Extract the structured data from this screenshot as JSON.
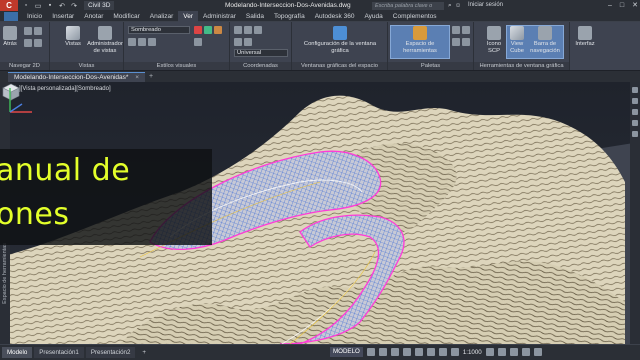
{
  "window": {
    "app_logo": "C",
    "product": "Civil 3D",
    "document_title": "Modelando-Interseccion-Dos-Avenidas.dwg",
    "search_placeholder": "Escriba palabra clave o frase",
    "signin": "Iniciar sesión",
    "controls": [
      "–",
      "□",
      "✕"
    ]
  },
  "ribbon_tabs": [
    {
      "label": "Inicio",
      "active": false
    },
    {
      "label": "Insertar",
      "active": false
    },
    {
      "label": "Anotar",
      "active": false
    },
    {
      "label": "Modificar",
      "active": false
    },
    {
      "label": "Analizar",
      "active": false
    },
    {
      "label": "Ver",
      "active": true
    },
    {
      "label": "Administrar",
      "active": false
    },
    {
      "label": "Salida",
      "active": false
    },
    {
      "label": "Topografía",
      "active": false
    },
    {
      "label": "Autodesk 360",
      "active": false
    },
    {
      "label": "Ayuda",
      "active": false
    },
    {
      "label": "Complementos",
      "active": false
    }
  ],
  "ribbon": {
    "panels": {
      "navigate": "Navegar 2D",
      "views": "Vistas",
      "visual_styles": "Estilos visuales",
      "coordinates": "Coordenadas",
      "model_viewports": "Ventanas gráficas del espacio modelo",
      "palettes": "Paletas",
      "window_tools": "Herramientas de ventana gráfica",
      "interface": "Interfaz"
    },
    "buttons": {
      "orbit": "Atrás",
      "views": "Vistas",
      "view_manager": "Administrador de vistas",
      "visual_style_value": "Sombreado",
      "ucs_value": "Universal",
      "viewport_config": "Configuración de la ventana gráfica",
      "tool_palettes": "Espacio de herramientas",
      "ucs_icon": "Icono SCP",
      "view_cube": "View Cube",
      "nav_bar": "Barra de navegación",
      "interface": "Interfaz"
    }
  },
  "doc_tab": {
    "label": "Modelando-Interseccion-Dos-Avenidas*",
    "close": "×",
    "add": "+"
  },
  "viewport": {
    "label": "[–][Vista personalizada][Sombreado]",
    "side_palette_label": "Espacio de herramientas",
    "overlay_line1": "anual de",
    "overlay_line2": "ones",
    "overlay_color": "#e3ff2a"
  },
  "status_bar": {
    "layout_tabs": [
      {
        "label": "Modelo",
        "active": true
      },
      {
        "label": "Presentación1",
        "active": false
      },
      {
        "label": "Presentación2",
        "active": false
      }
    ],
    "add_tab": "+",
    "model_button": "MODELO",
    "scale": "1:1000"
  },
  "colors": {
    "terrain": "#ddd5bc",
    "contours": "#6b5f47",
    "corridor_edge": "#ff3bd8",
    "corridor_mesh": "#2a5fd6"
  }
}
